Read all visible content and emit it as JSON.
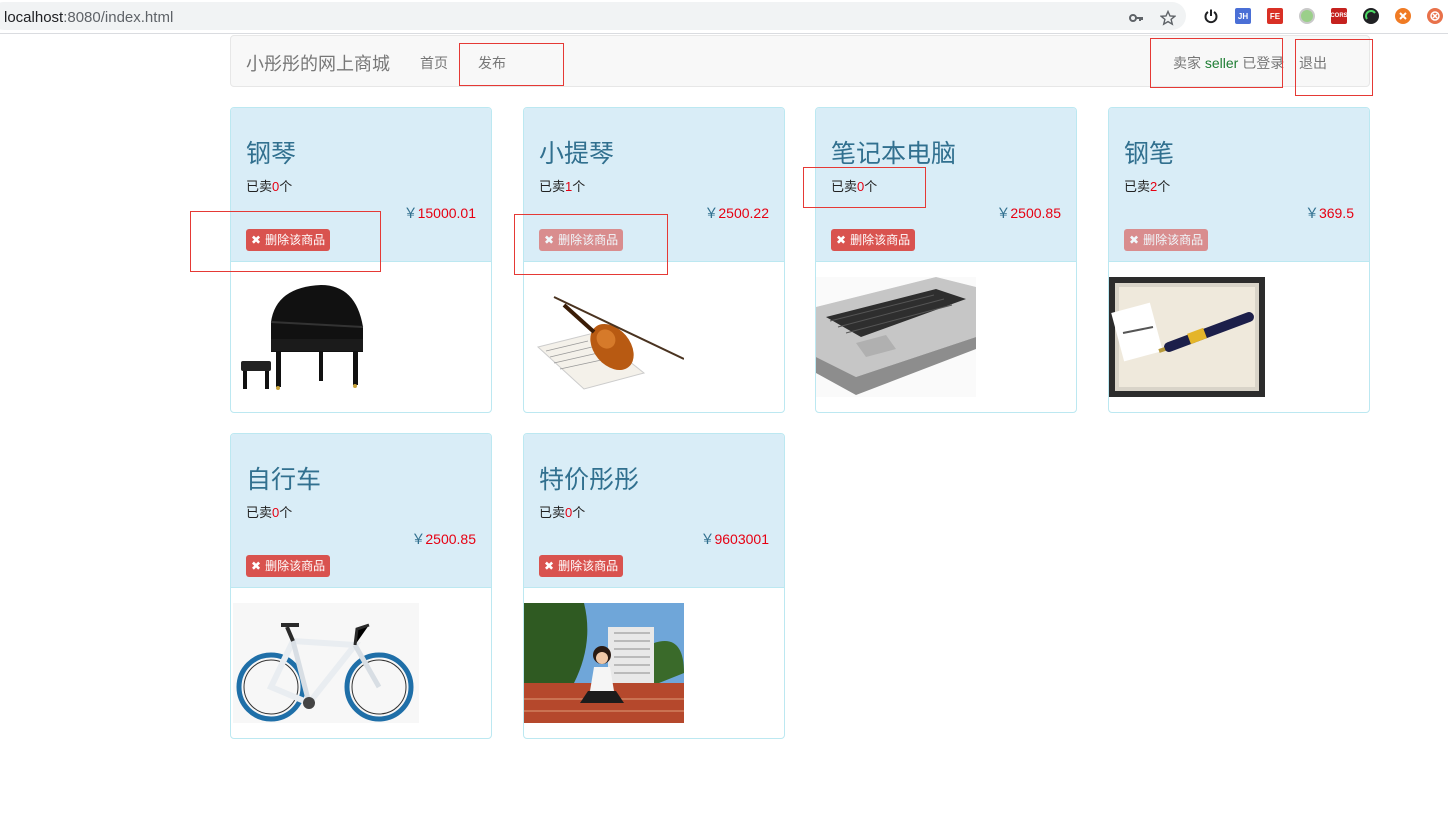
{
  "browser": {
    "url_host": "localhost",
    "url_path": ":8080/index.html",
    "extensions": [
      {
        "name": "key-icon",
        "color": "#5f6368"
      },
      {
        "name": "star-icon",
        "color": "#5f6368"
      },
      {
        "name": "power-icon",
        "color": "#202124"
      },
      {
        "name": "jh-extension-icon",
        "label": "JH",
        "color": "#4a6fd6"
      },
      {
        "name": "fe-extension-icon",
        "label": "FE",
        "color": "#d93025"
      },
      {
        "name": "green-dot-extension-icon",
        "color": "#9bcf8a"
      },
      {
        "name": "cors-extension-icon",
        "label": "CORS",
        "color": "#c5221f"
      },
      {
        "name": "dark-gauge-extension-icon",
        "color": "#202124"
      },
      {
        "name": "orange-extension-icon",
        "color": "#f07b24"
      },
      {
        "name": "red-x-extension-icon",
        "color": "#e8714a"
      }
    ]
  },
  "navbar": {
    "brand": "小彤彤的网上商城",
    "home": "首页",
    "publish": "发布",
    "status_prefix": "卖家 ",
    "username": "seller",
    "status_suffix": " 已登录",
    "logout": "退出"
  },
  "labels": {
    "sold_prefix": "已卖",
    "sold_suffix": "个",
    "currency": "￥",
    "delete": "删除该商品",
    "delete_icon": "✖"
  },
  "products": [
    {
      "title": "钢琴",
      "sold": "0",
      "price": "15000.01",
      "image": "grand-piano"
    },
    {
      "title": "小提琴",
      "sold": "1",
      "price": "2500.22",
      "image": "violin-on-sheet-music"
    },
    {
      "title": "笔记本电脑",
      "sold": "0",
      "price": "2500.85",
      "image": "silver-laptop"
    },
    {
      "title": "钢笔",
      "sold": "2",
      "price": "369.5",
      "image": "fountain-pen-in-case"
    },
    {
      "title": "自行车",
      "sold": "0",
      "price": "2500.85",
      "image": "mountain-bike"
    },
    {
      "title": "特价彤彤",
      "sold": "0",
      "price": "9603001",
      "image": "girl-sitting-on-track"
    }
  ],
  "colors": {
    "accent_red": "#e60012",
    "panel_bg": "#d9edf7",
    "panel_title": "#31708f",
    "danger": "#d9534f",
    "annotation": "#e53935"
  }
}
